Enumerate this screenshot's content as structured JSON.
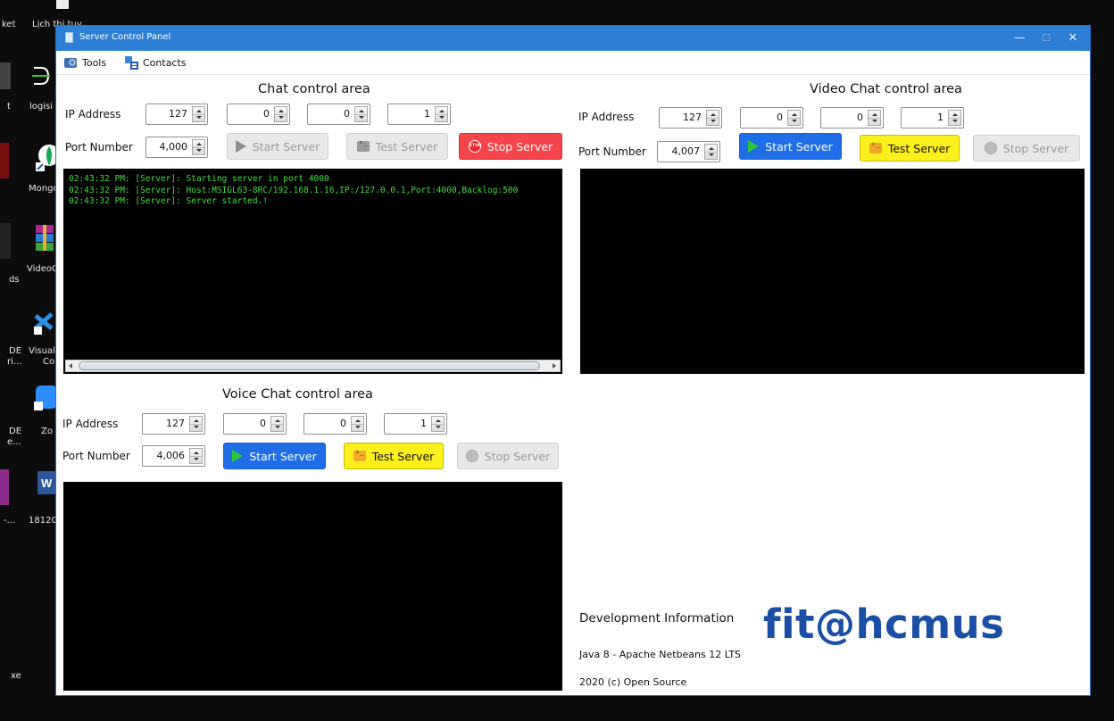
{
  "desktop": {
    "items": [
      {
        "label": "ket"
      },
      {
        "label": "Lịch thi tuy"
      },
      {
        "label": "t"
      },
      {
        "label": "logisi"
      },
      {
        "label": "Mongo"
      },
      {
        "label": "VideoC"
      },
      {
        "label": "ds"
      },
      {
        "label": "DE"
      },
      {
        "label": "Visual"
      },
      {
        "label": "ri..."
      },
      {
        "label": "Co"
      },
      {
        "label": "DE"
      },
      {
        "label": "Zo"
      },
      {
        "label": "e..."
      },
      {
        "label": "-..."
      },
      {
        "label": "18120"
      },
      {
        "label": "xe"
      }
    ]
  },
  "window": {
    "title": "Server Control Panel",
    "controls": {
      "minimize": "—",
      "maximize": "☐",
      "close": "✕"
    }
  },
  "menu": {
    "tools": "Tools",
    "contacts": "Contacts"
  },
  "chat": {
    "title": "Chat control area",
    "ip_label": "IP Address",
    "ip": [
      "127",
      "0",
      "0",
      "1"
    ],
    "port_label": "Port Number",
    "port": "4,000",
    "start": "Start Server",
    "test": "Test Server",
    "stop": "Stop Server",
    "log": [
      "02:43:32 PM: [Server]: Starting server in port 4000",
      "02:43:32 PM: [Server]: Host:MSIGL63-8RC/192.168.1.16,IP:/127.0.0.1,Port:4000,Backlog:500",
      "02:43:32 PM: [Server]: Server started.!"
    ]
  },
  "video": {
    "title": "Video Chat control area",
    "ip_label": "IP Address",
    "ip": [
      "127",
      "0",
      "0",
      "1"
    ],
    "port_label": "Port Number",
    "port": "4,007",
    "start": "Start Server",
    "test": "Test Server",
    "stop": "Stop Server"
  },
  "voice": {
    "title": "Voice Chat control area",
    "ip_label": "IP Address",
    "ip": [
      "127",
      "0",
      "0",
      "1"
    ],
    "port_label": "Port Number",
    "port": "4,006",
    "start": "Start Server",
    "test": "Test Server",
    "stop": "Stop Server"
  },
  "dev": {
    "heading": "Development Information",
    "line1": "Java 8 - Apache Netbeans 12 LTS",
    "line2": "2020 (c) Open Source",
    "logo": "fit@hcmus"
  },
  "colors": {
    "titlebar": "#2d7fd6",
    "start_blue": "#1f6ee8",
    "test_yellow": "#fbef1c",
    "stop_red": "#f5444a",
    "log_green": "#3ee03a",
    "logo_blue": "#1b4fa6"
  }
}
